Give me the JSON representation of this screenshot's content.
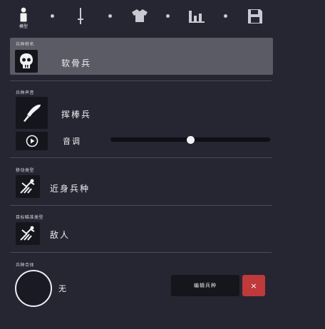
{
  "tabs": {
    "model_label": "模型",
    "items": [
      "person-icon",
      "sword-icon",
      "shirt-icon",
      "stats-icon",
      "save-icon"
    ]
  },
  "unit_name": {
    "section_label": "兵种称名",
    "value": "软骨兵"
  },
  "unit_voice": {
    "section_label": "兵种声音",
    "value": "挥棒兵",
    "pitch_label": "音调",
    "pitch_level": 0.5
  },
  "move_type": {
    "section_label": "移动类型",
    "value": "近身兵种"
  },
  "target_type": {
    "section_label": "目标瞄准类型",
    "value": "敌人"
  },
  "unit_combine": {
    "section_label": "兵种合体",
    "value": "无",
    "edit_button": "编辑兵种",
    "close_button": "×"
  },
  "colors": {
    "background": "#262532",
    "selected_row": "#5b5b66",
    "close_red": "#c0393b"
  }
}
